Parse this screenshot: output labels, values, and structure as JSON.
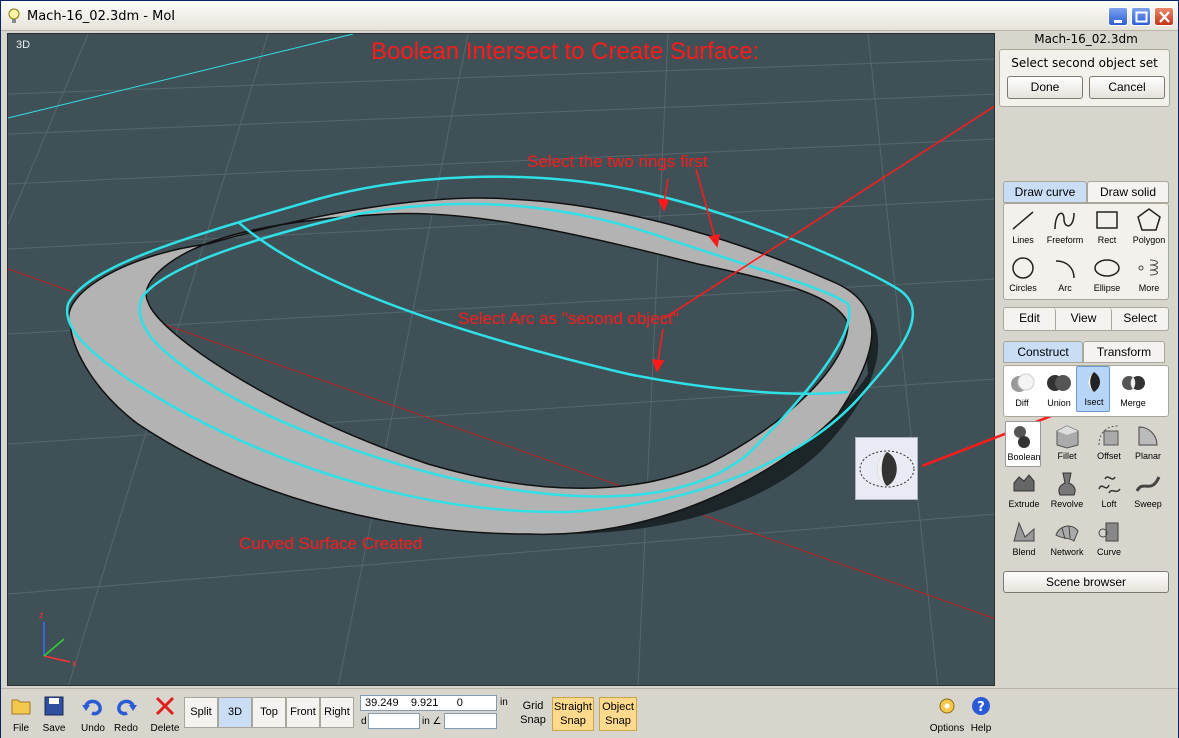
{
  "window": {
    "title": "Mach-16_02.3dm - MoI"
  },
  "viewport": {
    "name": "3D",
    "headline": "Boolean Intersect to Create Surface:",
    "notes": {
      "rings": "Select the two rings first",
      "arc": "Select Arc as \"second object\"",
      "surface": "Curved Surface Created"
    },
    "axes": {
      "x": "x",
      "z": "z"
    }
  },
  "panel": {
    "file_name": "Mach-16_02.3dm",
    "prompt": "Select second object set",
    "done_label": "Done",
    "cancel_label": "Cancel",
    "draw_tabs": [
      "Draw curve",
      "Draw solid"
    ],
    "draw_tools": [
      "Lines",
      "Freeform",
      "Rect",
      "Polygon",
      "Circles",
      "Arc",
      "Ellipse",
      "More"
    ],
    "mode_tabs": [
      "Edit",
      "View",
      "Select"
    ],
    "construct_tabs": [
      "Construct",
      "Transform"
    ],
    "boolean_tools": [
      "Diff",
      "Union",
      "Isect",
      "Merge"
    ],
    "construct_tools": [
      "Boolean",
      "Fillet",
      "Offset",
      "Planar",
      "Extrude",
      "Revolve",
      "Loft",
      "Sweep",
      "Blend",
      "Network",
      "Curve"
    ],
    "scene_browser": "Scene browser"
  },
  "bottom": {
    "file_label": "File",
    "save_label": "Save",
    "undo_label": "Undo",
    "redo_label": "Redo",
    "delete_label": "Delete",
    "views": [
      "Split",
      "3D",
      "Top",
      "Front",
      "Right"
    ],
    "active_view": "3D",
    "coords": "39.249    9.921      0",
    "unit": "in",
    "dist_prefix": "d",
    "angle_unit": "in ∠",
    "grid_snap": [
      "Grid",
      "Snap"
    ],
    "straight_snap": [
      "Straight",
      "Snap"
    ],
    "object_snap": [
      "Object",
      "Snap"
    ],
    "options_label": "Options",
    "help_label": "Help"
  },
  "colors": {
    "viewport_bg": "#3f5157",
    "curve": "#2fe0e6",
    "annotation": "#ff1a1a",
    "active_tab": "#c9def5",
    "snap_on": "#ffd98c"
  }
}
